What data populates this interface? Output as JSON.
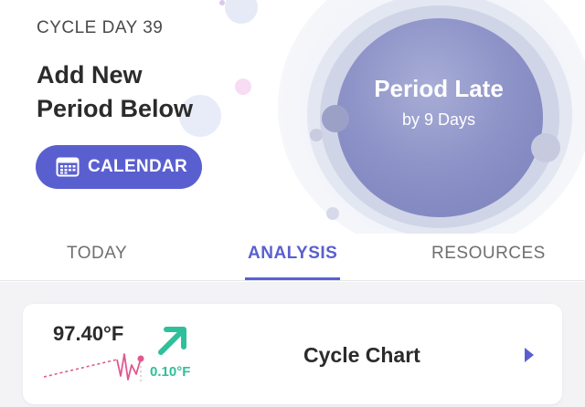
{
  "header": {
    "cycle_day": "CYCLE DAY 39",
    "add_title_line1": "Add New",
    "add_title_line2": "Period Below",
    "calendar_button": "CALENDAR"
  },
  "status": {
    "title": "Period Late",
    "subtitle": "by 9 Days"
  },
  "tabs": [
    {
      "label": "TODAY",
      "active": false
    },
    {
      "label": "ANALYSIS",
      "active": true
    },
    {
      "label": "RESOURCES",
      "active": false
    }
  ],
  "cycle_card": {
    "temperature": "97.40°F",
    "change": "0.10°F",
    "title": "Cycle Chart"
  },
  "colors": {
    "accent": "#5a5fd0",
    "trend_up": "#2fbf9a",
    "chart_line": "#e0588f"
  }
}
